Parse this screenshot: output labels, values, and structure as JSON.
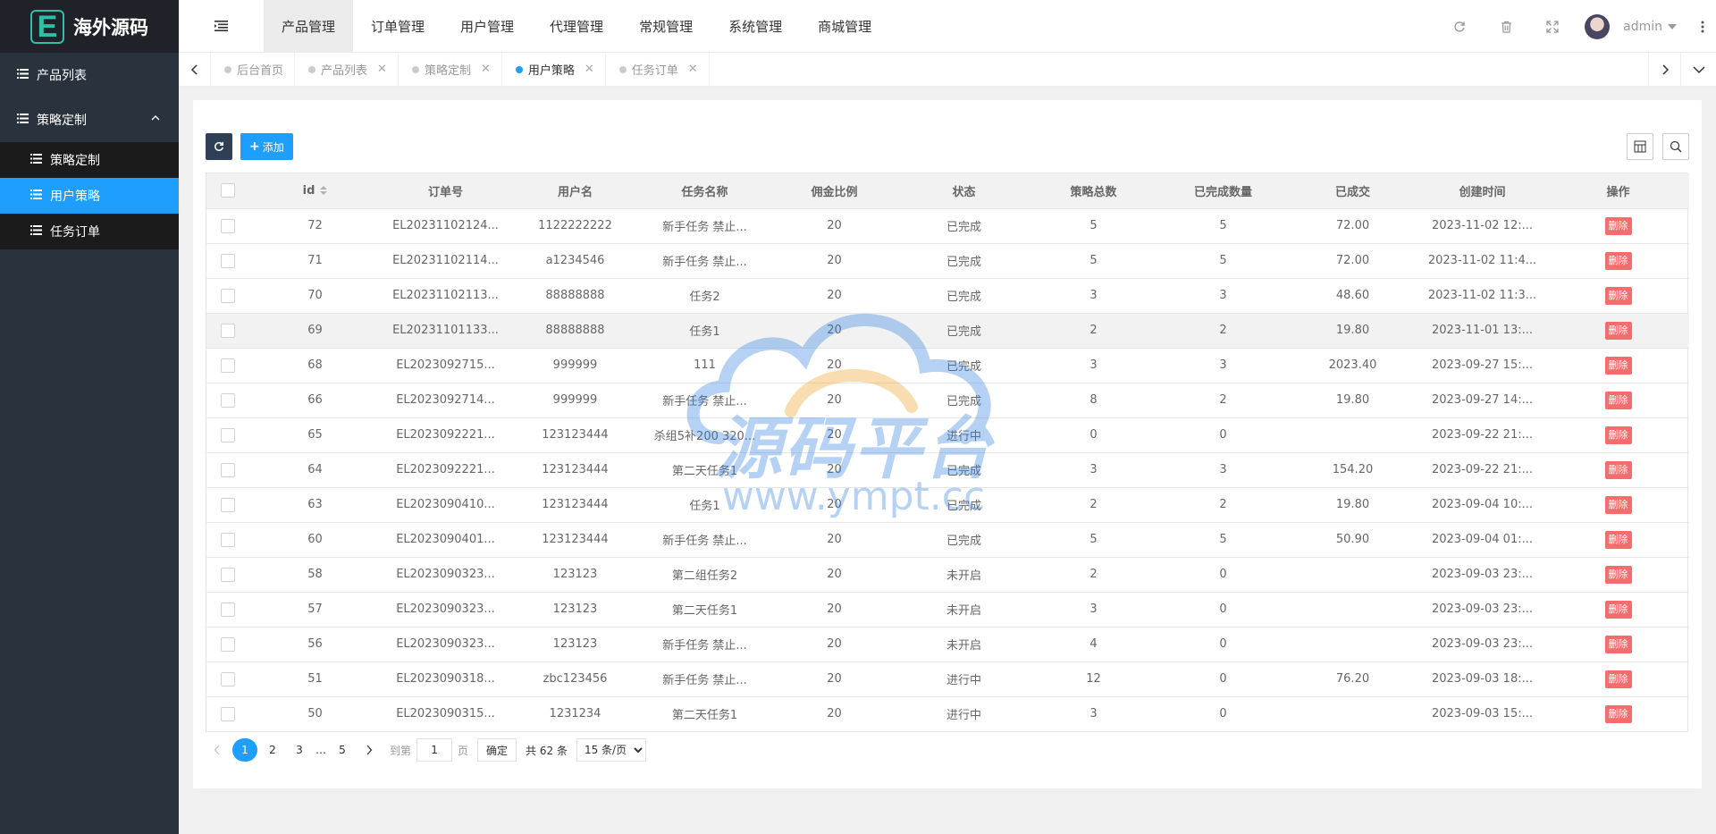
{
  "brand": {
    "logo_letter": "E",
    "name": "海外源码"
  },
  "sidebar": {
    "items": [
      {
        "label": "产品列表"
      },
      {
        "label": "策略定制",
        "expanded": true,
        "children": [
          {
            "label": "策略定制"
          },
          {
            "label": "用户策略",
            "active": true
          },
          {
            "label": "任务订单"
          }
        ]
      }
    ]
  },
  "topnav": [
    "产品管理",
    "订单管理",
    "用户管理",
    "代理管理",
    "常规管理",
    "系统管理",
    "商城管理"
  ],
  "header": {
    "username": "admin",
    "icons": [
      "refresh-icon",
      "trash-icon",
      "fullscreen-icon"
    ]
  },
  "tabs": [
    {
      "label": "后台首页",
      "closable": false
    },
    {
      "label": "产品列表",
      "closable": true
    },
    {
      "label": "策略定制",
      "closable": true
    },
    {
      "label": "用户策略",
      "closable": true,
      "active": true
    },
    {
      "label": "任务订单",
      "closable": true
    }
  ],
  "toolbar": {
    "add_label": "添加"
  },
  "table": {
    "columns": [
      "id",
      "订单号",
      "用户名",
      "任务名称",
      "佣金比例",
      "状态",
      "策略总数",
      "已完成数量",
      "已成交",
      "创建时间",
      "操作"
    ],
    "delete_label": "删除",
    "rows": [
      {
        "id": "72",
        "order": "EL20231102124...",
        "user": "1122222222",
        "task": "新手任务 禁止...",
        "rate": "20",
        "status": "已完成",
        "total": "5",
        "done": "5",
        "deal": "72.00",
        "time": "2023-11-02 12:..."
      },
      {
        "id": "71",
        "order": "EL20231102114...",
        "user": "a1234546",
        "task": "新手任务 禁止...",
        "rate": "20",
        "status": "已完成",
        "total": "5",
        "done": "5",
        "deal": "72.00",
        "time": "2023-11-02 11:4..."
      },
      {
        "id": "70",
        "order": "EL20231102113...",
        "user": "88888888",
        "task": "任务2",
        "rate": "20",
        "status": "已完成",
        "total": "3",
        "done": "3",
        "deal": "48.60",
        "time": "2023-11-02 11:3..."
      },
      {
        "id": "69",
        "order": "EL20231101133...",
        "user": "88888888",
        "task": "任务1",
        "rate": "20",
        "status": "已完成",
        "total": "2",
        "done": "2",
        "deal": "19.80",
        "time": "2023-11-01 13:..."
      },
      {
        "id": "68",
        "order": "EL2023092715...",
        "user": "999999",
        "task": "111",
        "rate": "20",
        "status": "已完成",
        "total": "3",
        "done": "3",
        "deal": "2023.40",
        "time": "2023-09-27 15:..."
      },
      {
        "id": "66",
        "order": "EL2023092714...",
        "user": "999999",
        "task": "新手任务 禁止...",
        "rate": "20",
        "status": "已完成",
        "total": "8",
        "done": "2",
        "deal": "19.80",
        "time": "2023-09-27 14:..."
      },
      {
        "id": "65",
        "order": "EL2023092221...",
        "user": "123123444",
        "task": "杀组5补200 320...",
        "rate": "20",
        "status": "进行中",
        "total": "0",
        "done": "0",
        "deal": "",
        "time": "2023-09-22 21:..."
      },
      {
        "id": "64",
        "order": "EL2023092221...",
        "user": "123123444",
        "task": "第二天任务1",
        "rate": "20",
        "status": "已完成",
        "total": "3",
        "done": "3",
        "deal": "154.20",
        "time": "2023-09-22 21:..."
      },
      {
        "id": "63",
        "order": "EL2023090410...",
        "user": "123123444",
        "task": "任务1",
        "rate": "20",
        "status": "已完成",
        "total": "2",
        "done": "2",
        "deal": "19.80",
        "time": "2023-09-04 10:..."
      },
      {
        "id": "60",
        "order": "EL2023090401...",
        "user": "123123444",
        "task": "新手任务 禁止...",
        "rate": "20",
        "status": "已完成",
        "total": "5",
        "done": "5",
        "deal": "50.90",
        "time": "2023-09-04 01:..."
      },
      {
        "id": "58",
        "order": "EL2023090323...",
        "user": "123123",
        "task": "第二组任务2",
        "rate": "20",
        "status": "未开启",
        "total": "2",
        "done": "0",
        "deal": "",
        "time": "2023-09-03 23:..."
      },
      {
        "id": "57",
        "order": "EL2023090323...",
        "user": "123123",
        "task": "第二天任务1",
        "rate": "20",
        "status": "未开启",
        "total": "3",
        "done": "0",
        "deal": "",
        "time": "2023-09-03 23:..."
      },
      {
        "id": "56",
        "order": "EL2023090323...",
        "user": "123123",
        "task": "新手任务 禁止...",
        "rate": "20",
        "status": "未开启",
        "total": "4",
        "done": "0",
        "deal": "",
        "time": "2023-09-03 23:..."
      },
      {
        "id": "51",
        "order": "EL2023090318...",
        "user": "zbc123456",
        "task": "新手任务 禁止...",
        "rate": "20",
        "status": "进行中",
        "total": "12",
        "done": "0",
        "deal": "76.20",
        "time": "2023-09-03 18:..."
      },
      {
        "id": "50",
        "order": "EL2023090315...",
        "user": "1231234",
        "task": "第二天任务1",
        "rate": "20",
        "status": "进行中",
        "total": "3",
        "done": "0",
        "deal": "",
        "time": "2023-09-03 15:..."
      }
    ]
  },
  "pager": {
    "pages": [
      "1",
      "2",
      "3",
      "…",
      "5"
    ],
    "current": "1",
    "goto_label": "到第",
    "goto_value": "1",
    "page_unit": "页",
    "ok_label": "确定",
    "total_text": "共 62 条",
    "page_size": "15 条/页"
  },
  "watermark": {
    "text": "源码平台",
    "url": "www.ympt.cc"
  }
}
